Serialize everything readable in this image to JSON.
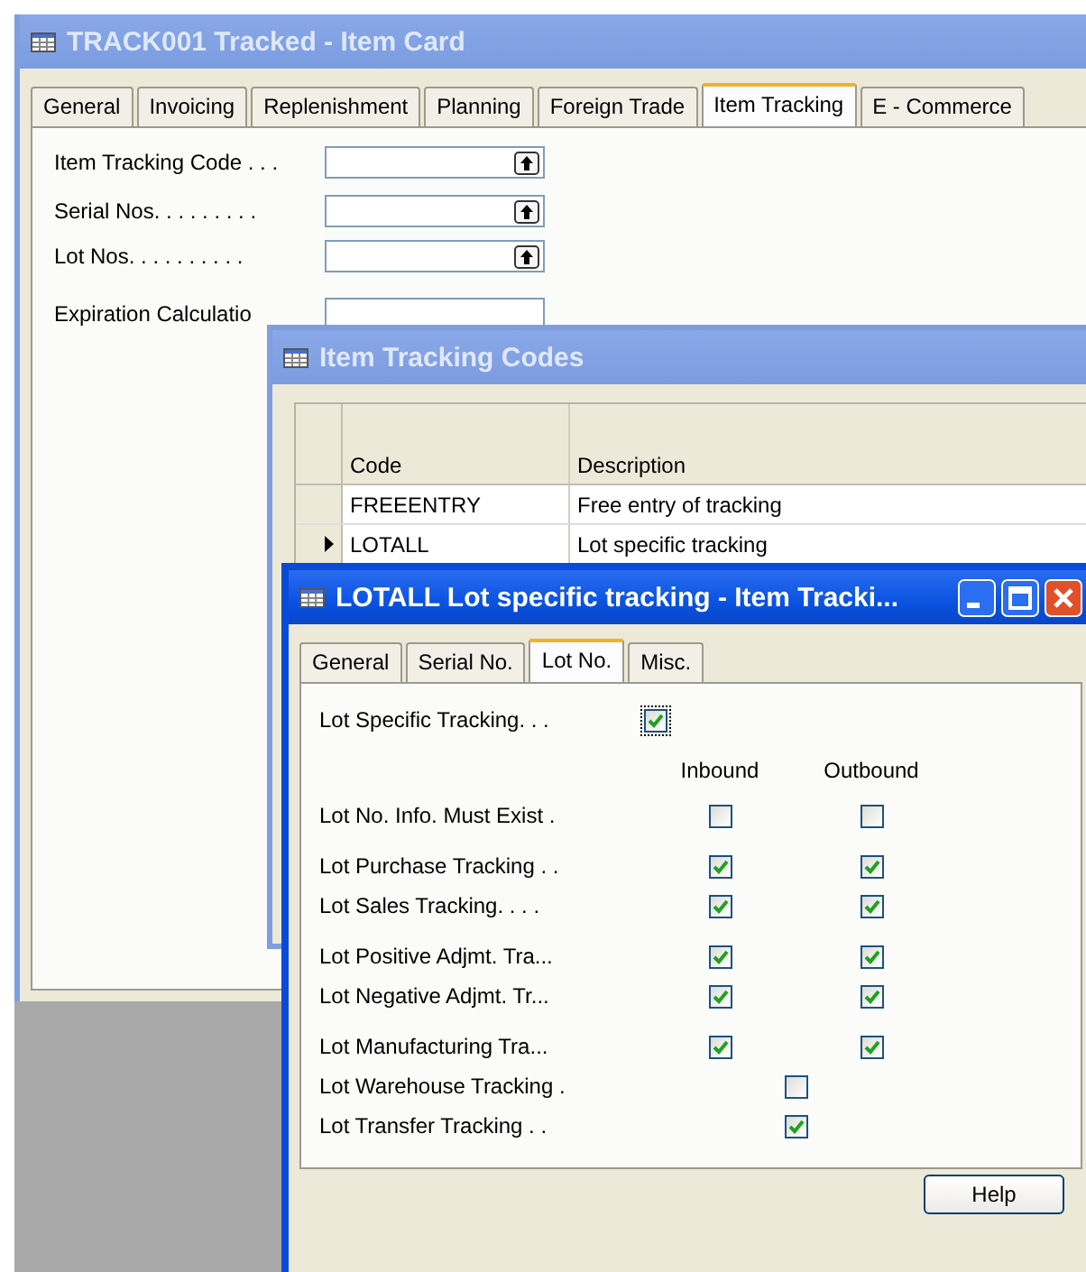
{
  "item_card": {
    "title": "TRACK001 Tracked - Item Card",
    "tabs": [
      {
        "label": "General",
        "selected": false
      },
      {
        "label": "Invoicing",
        "selected": false
      },
      {
        "label": "Replenishment",
        "selected": false
      },
      {
        "label": "Planning",
        "selected": false
      },
      {
        "label": "Foreign Trade",
        "selected": false
      },
      {
        "label": "Item Tracking",
        "selected": true
      },
      {
        "label": "E - Commerce",
        "selected": false
      }
    ],
    "fields": [
      {
        "label": "Item Tracking Code . . .",
        "lookup": true
      },
      {
        "label": "Serial Nos. . . . . . . . .",
        "lookup": true
      },
      {
        "label": "Lot Nos. . . . . . . . . .",
        "lookup": true
      },
      {
        "label": "Expiration Calculatio",
        "lookup": false
      }
    ]
  },
  "codes_window": {
    "title": "Item Tracking Codes",
    "columns": [
      "Code",
      "Description"
    ],
    "rows": [
      {
        "code": "FREEENTRY",
        "description": "Free entry of tracking",
        "selected": false
      },
      {
        "code": "LOTALL",
        "description": "Lot specific tracking",
        "selected": true
      }
    ]
  },
  "lot_window": {
    "title": "LOTALL Lot specific tracking - Item Tracki...",
    "tabs": [
      {
        "label": "General",
        "selected": false
      },
      {
        "label": "Serial No.",
        "selected": false
      },
      {
        "label": "Lot No.",
        "selected": true
      },
      {
        "label": "Misc.",
        "selected": false
      }
    ],
    "specific": {
      "label": "Lot Specific Tracking. . .",
      "checked": true
    },
    "column_headers": [
      "Inbound",
      "Outbound"
    ],
    "rows": [
      {
        "kind": "pair",
        "label": "Lot No. Info. Must Exist .",
        "inbound": false,
        "outbound": false
      },
      {
        "kind": "pair",
        "label": "Lot Purchase Tracking . .",
        "inbound": true,
        "outbound": true
      },
      {
        "kind": "pair",
        "label": "Lot Sales Tracking. . . .",
        "inbound": true,
        "outbound": true
      },
      {
        "kind": "pair",
        "label": "Lot Positive Adjmt. Tra...",
        "inbound": true,
        "outbound": true
      },
      {
        "kind": "pair",
        "label": "Lot Negative Adjmt. Tr...",
        "inbound": true,
        "outbound": true
      },
      {
        "kind": "pair",
        "label": "Lot Manufacturing Tra...",
        "inbound": true,
        "outbound": true
      },
      {
        "kind": "single",
        "label": "Lot Warehouse Tracking .",
        "checked": false
      },
      {
        "kind": "single",
        "label": "Lot Transfer Tracking . .",
        "checked": true
      }
    ],
    "button": "Help"
  }
}
